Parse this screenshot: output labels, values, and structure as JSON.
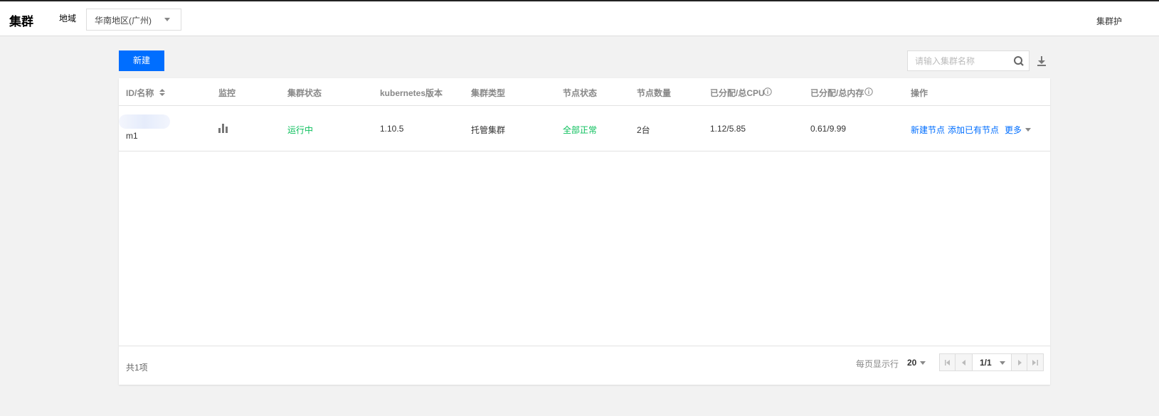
{
  "header": {
    "title": "集群",
    "region_label": "地域",
    "region_value": "华南地区(广州)",
    "right_text": "集群护"
  },
  "toolbar": {
    "new_label": "新建",
    "search_placeholder": "请输入集群名称"
  },
  "table": {
    "columns": [
      "ID/名称",
      "监控",
      "集群状态",
      "kubernetes版本",
      "集群类型",
      "节点状态",
      "节点数量",
      "已分配/总CPU",
      "已分配/总内存",
      "操作"
    ],
    "rows": [
      {
        "name": "m1",
        "status": "运行中",
        "k8s_version": "1.10.5",
        "type": "托管集群",
        "node_status": "全部正常",
        "node_count": "2台",
        "cpu": "1.12/5.85",
        "memory": "0.61/9.99",
        "actions": [
          "新建节点",
          "添加已有节点",
          "更多"
        ]
      }
    ]
  },
  "footer": {
    "total": "共1项",
    "per_page_label": "每页显示行",
    "per_page": "20",
    "page": "1/1"
  },
  "colors": {
    "accent": "#006eff",
    "success": "#0abf5b"
  }
}
